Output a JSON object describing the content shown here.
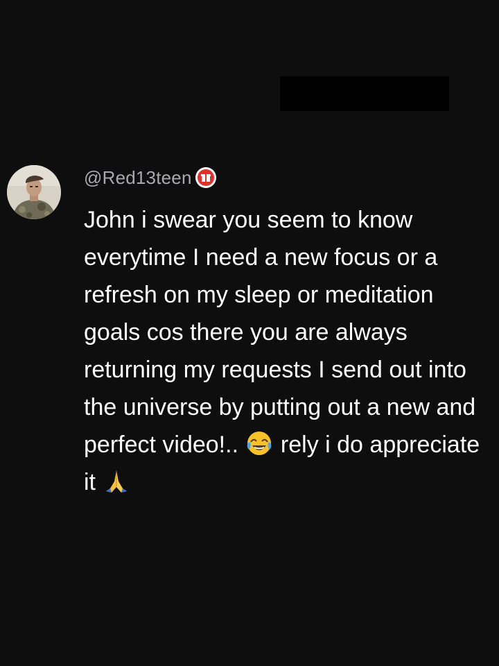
{
  "comment": {
    "username": "@Red13teen",
    "badge_icon": "gift-box-icon",
    "text_part1": "John i swear you seem to know everytime I need a new focus or a refresh on my sleep or meditation goals cos there you are always returning my requests I send out into the universe by putting out a new and perfect video!.. ",
    "emoji1": "😂",
    "text_part2": " rely i do appreciate it ",
    "emoji2": "🙏"
  },
  "colors": {
    "background": "#0e0e0f",
    "username": "#a9a9ad",
    "text": "#ffffff",
    "badge": "#e0302c"
  }
}
